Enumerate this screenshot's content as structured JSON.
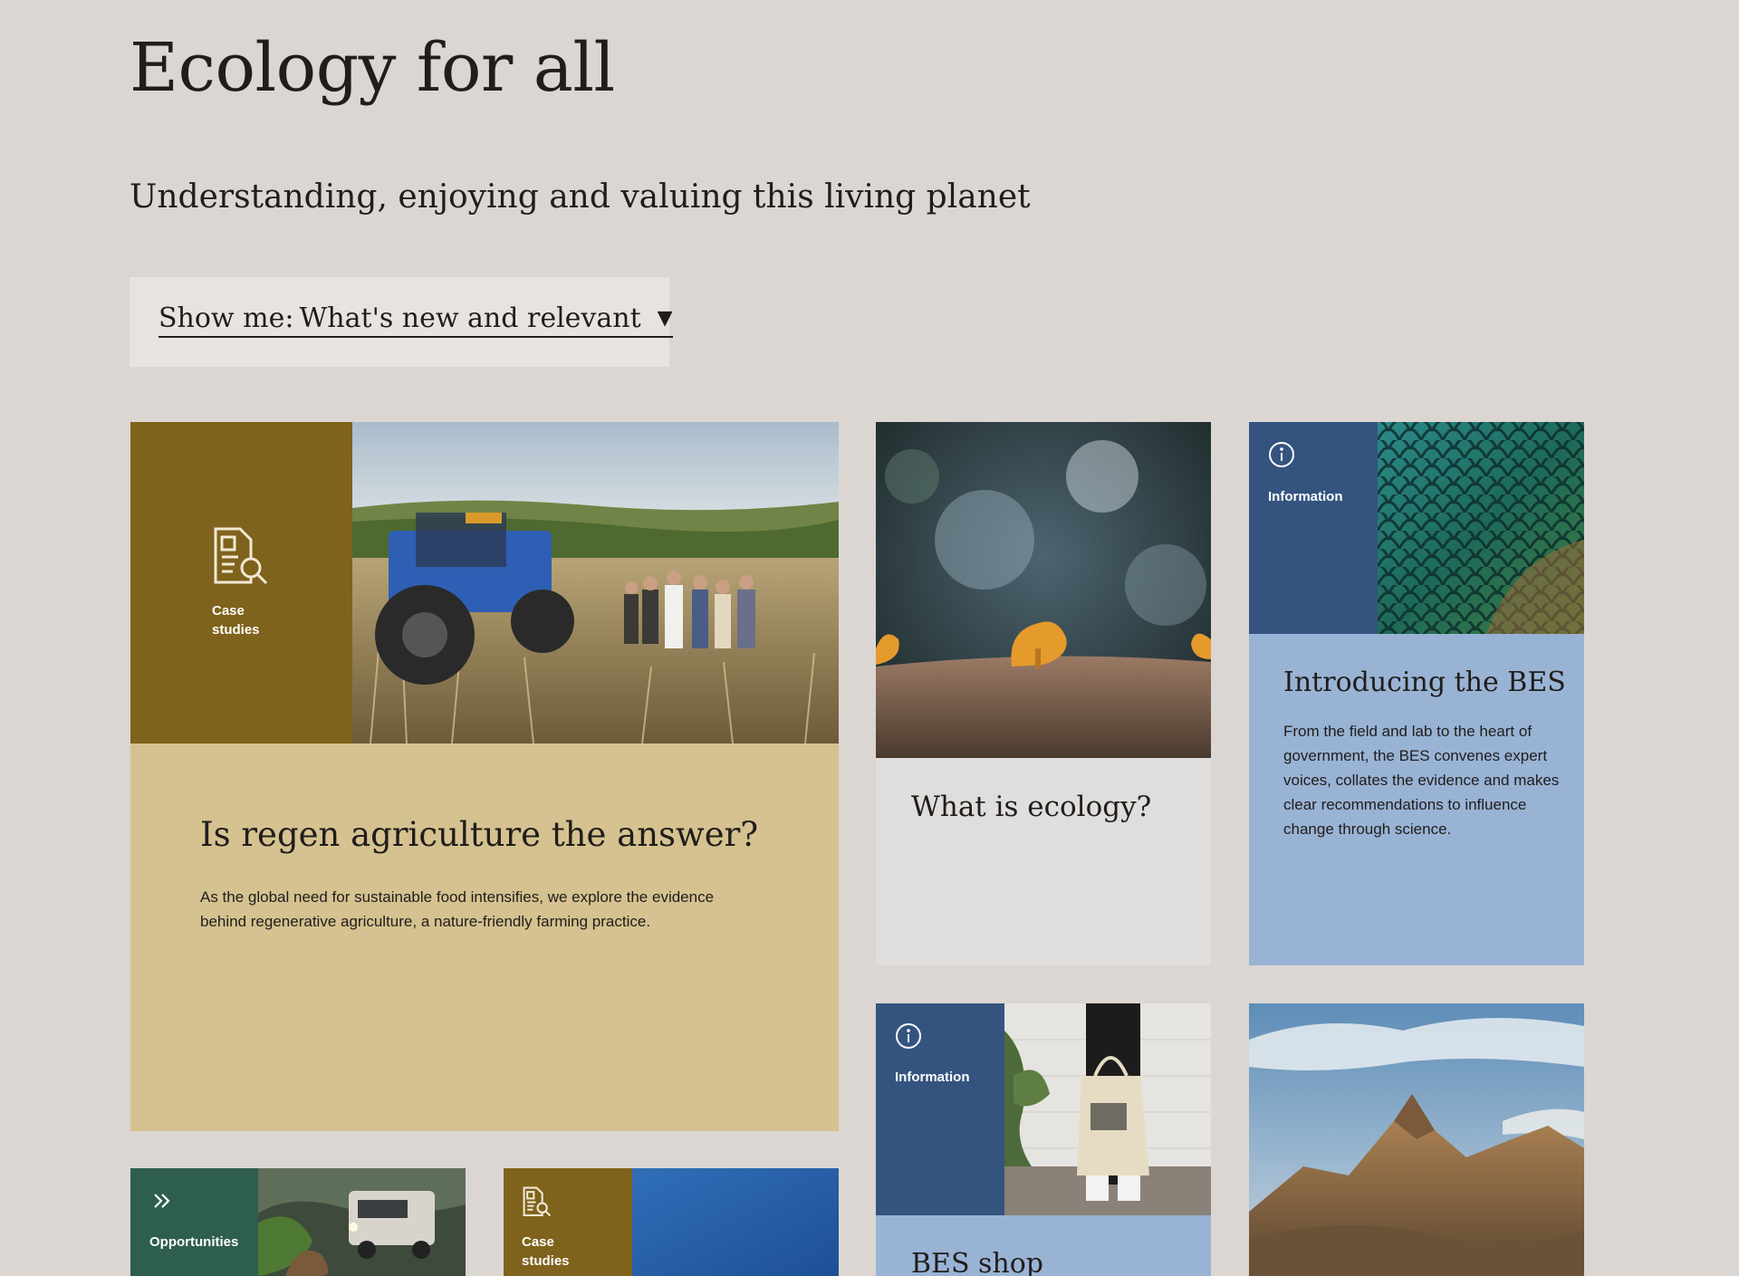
{
  "page": {
    "title": "Ecology for all",
    "subtitle": "Understanding, enjoying and valuing this living planet"
  },
  "filter": {
    "prefix": "Show me:",
    "value": "What's new and relevant",
    "arrow": "▼"
  },
  "cards": [
    {
      "tag": "Case studies",
      "tag_icon": "document-search-icon",
      "heading": "Is regen agriculture the answer?",
      "body": "As the global need for sustainable food intensifies, we explore the evidence behind regenerative agriculture, a nature-friendly farming practice."
    },
    {
      "heading": "What is ecology?"
    },
    {
      "tag": "Information",
      "tag_icon": "info-icon",
      "heading": "Introducing the BES",
      "body": "From the field and lab to the heart of government, the BES convenes expert voices, collates the evidence and makes clear recommendations to influence change through science."
    },
    {
      "tag": "Information",
      "tag_icon": "info-icon",
      "heading": "BES shop"
    },
    {
      "tag": "Opportunities",
      "tag_icon": "double-chevron-right-icon"
    },
    {
      "tag": "Case studies",
      "tag_icon": "document-search-icon"
    }
  ],
  "colors": {
    "background": "#dbd6d2",
    "case_studies_dark": "#7f621b",
    "case_studies_light": "#d5c290",
    "information_dark": "#34547f",
    "information_light": "#99b3d5",
    "opportunities_dark": "#2e5e4f",
    "neutral_panel": "#dfdedd"
  }
}
